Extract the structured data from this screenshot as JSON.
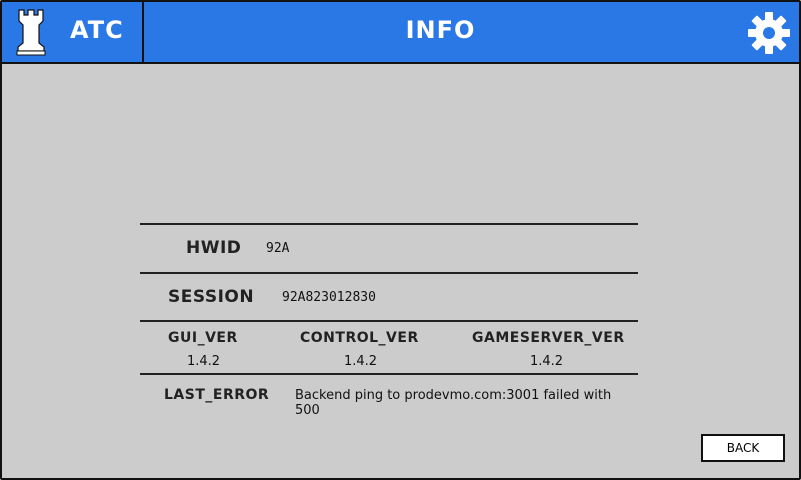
{
  "header": {
    "brand_title": "ATC",
    "brand_icon": "chess-rook-icon",
    "page_title": "INFO",
    "settings_icon": "gear-icon",
    "accent_color": "#2a77e6"
  },
  "info": {
    "hwid": {
      "label": "HWID",
      "value": "92A"
    },
    "session": {
      "label": "SESSION",
      "value": "92A823012830"
    },
    "versions": [
      {
        "label": "GUI_VER",
        "value": "1.4.2"
      },
      {
        "label": "CONTROL_VER",
        "value": "1.4.2"
      },
      {
        "label": "GAMESERVER_VER",
        "value": "1.4.2"
      }
    ],
    "last_error": {
      "label": "LAST_ERROR",
      "value": "Backend ping to prodevmo.com:3001 failed with 500"
    }
  },
  "actions": {
    "back_label": "BACK"
  }
}
